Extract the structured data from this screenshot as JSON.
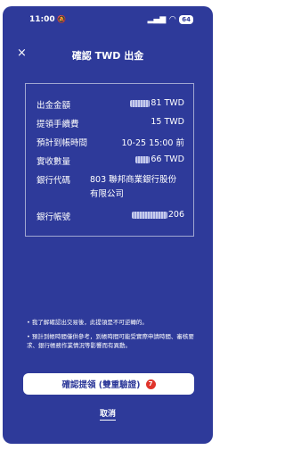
{
  "status_bar": {
    "time": "11:00",
    "battery": "64"
  },
  "header": {
    "close_symbol": "×",
    "title": "確認 TWD 出金"
  },
  "details": {
    "amount": {
      "label": "出金金額",
      "value_visible": "81 TWD"
    },
    "fee": {
      "label": "提領手續費",
      "value": "15 TWD"
    },
    "eta": {
      "label": "預計到帳時間",
      "value": "10-25 15:00 前"
    },
    "received": {
      "label": "實收數量",
      "value_visible": "66 TWD"
    },
    "bank_code": {
      "label": "銀行代碼",
      "value": "803 聯邦商業銀行股份有限公司"
    },
    "account": {
      "label": "銀行帳號",
      "value_visible": "206"
    }
  },
  "notes": [
    "我了解確認出交易後，此提領是不可逆轉的。",
    "預計到帳時間僅供參考，到帳時間可能受實際申請時間、審核要求、銀行帳務作業情況等影響而有異動。"
  ],
  "actions": {
    "confirm_label": "確認提領 (雙重驗證)",
    "confirm_badge": "7",
    "cancel_label": "取消"
  },
  "colors": {
    "background": "#2e3a9a",
    "button": "#ffffff",
    "badge": "#e0342b"
  }
}
